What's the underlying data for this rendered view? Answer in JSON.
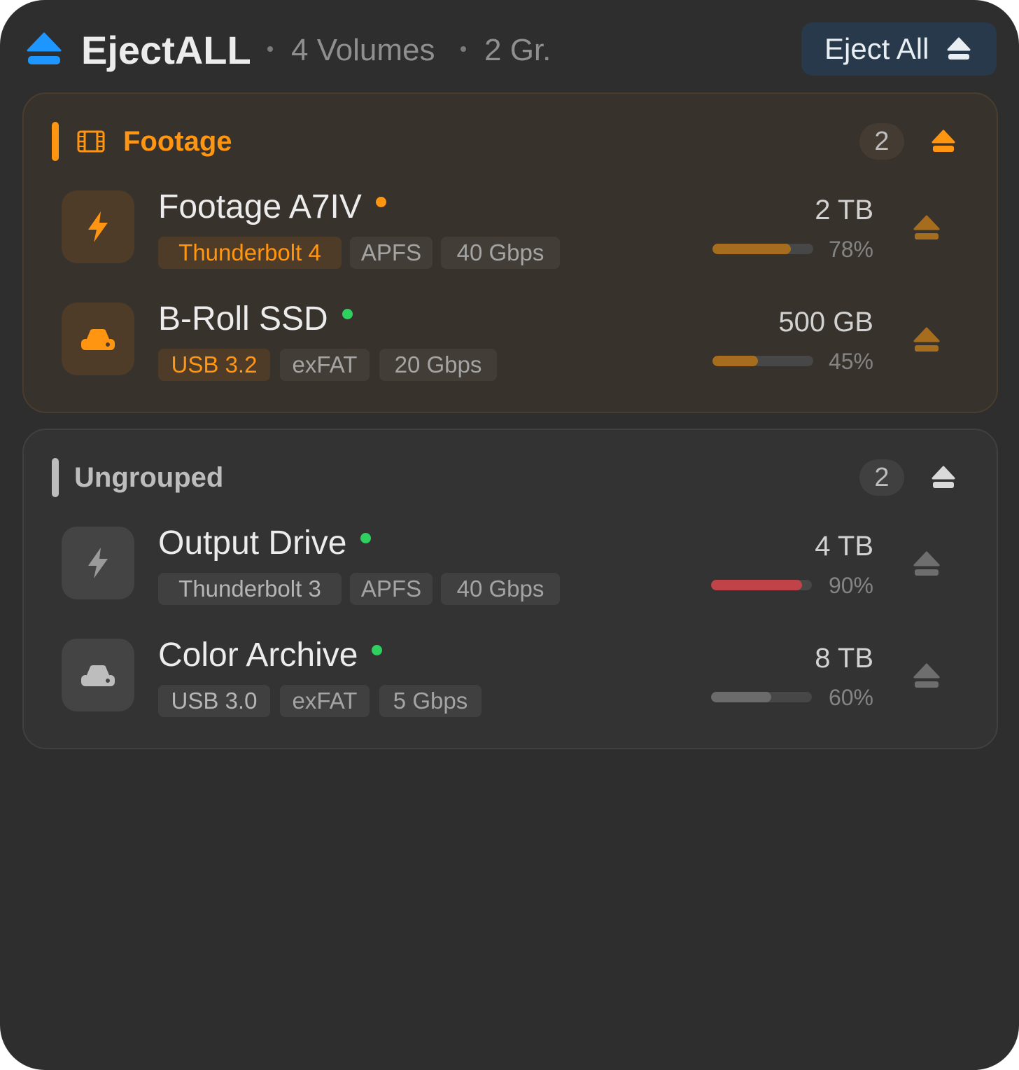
{
  "header": {
    "app_name": "EjectALL",
    "volumes": "4 Volumes",
    "groups": "2 Gr.",
    "eject_all_label": "Eject All",
    "app_icon": "eject-icon",
    "accent": "#1e96ff"
  },
  "groups": [
    {
      "title": "Footage",
      "count": "2",
      "icon": "film-icon",
      "accent": "#ff9511",
      "drives": [
        {
          "name": "Footage A7IV",
          "status_color": "#ff9511",
          "icon": "bolt-icon",
          "tags": [
            "Thunderbolt 4",
            "APFS",
            "40 Gbps"
          ],
          "capacity": "2 TB",
          "usage_label": "78%",
          "usage": 0.78,
          "bar_color": "#a66d1f"
        },
        {
          "name": "B-Roll SSD",
          "status_color": "#2fd060",
          "icon": "drive-icon",
          "tags": [
            "USB 3.2",
            "exFAT",
            "20 Gbps"
          ],
          "capacity": "500 GB",
          "usage_label": "45%",
          "usage": 0.45,
          "bar_color": "#a66d1f"
        }
      ]
    },
    {
      "title": "Ungrouped",
      "count": "2",
      "icon": "",
      "accent": "#bdbdbd",
      "drives": [
        {
          "name": "Output Drive",
          "status_color": "#2fd060",
          "icon": "bolt-icon",
          "tags": [
            "Thunderbolt 3",
            "APFS",
            "40 Gbps"
          ],
          "capacity": "4 TB",
          "usage_label": "90%",
          "usage": 0.9,
          "bar_color": "#c0434a"
        },
        {
          "name": "Color Archive",
          "status_color": "#2fd060",
          "icon": "drive-icon",
          "tags": [
            "USB 3.0",
            "exFAT",
            "5 Gbps"
          ],
          "capacity": "8 TB",
          "usage_label": "60%",
          "usage": 0.6,
          "bar_color": "#6b6b6b"
        }
      ]
    }
  ]
}
